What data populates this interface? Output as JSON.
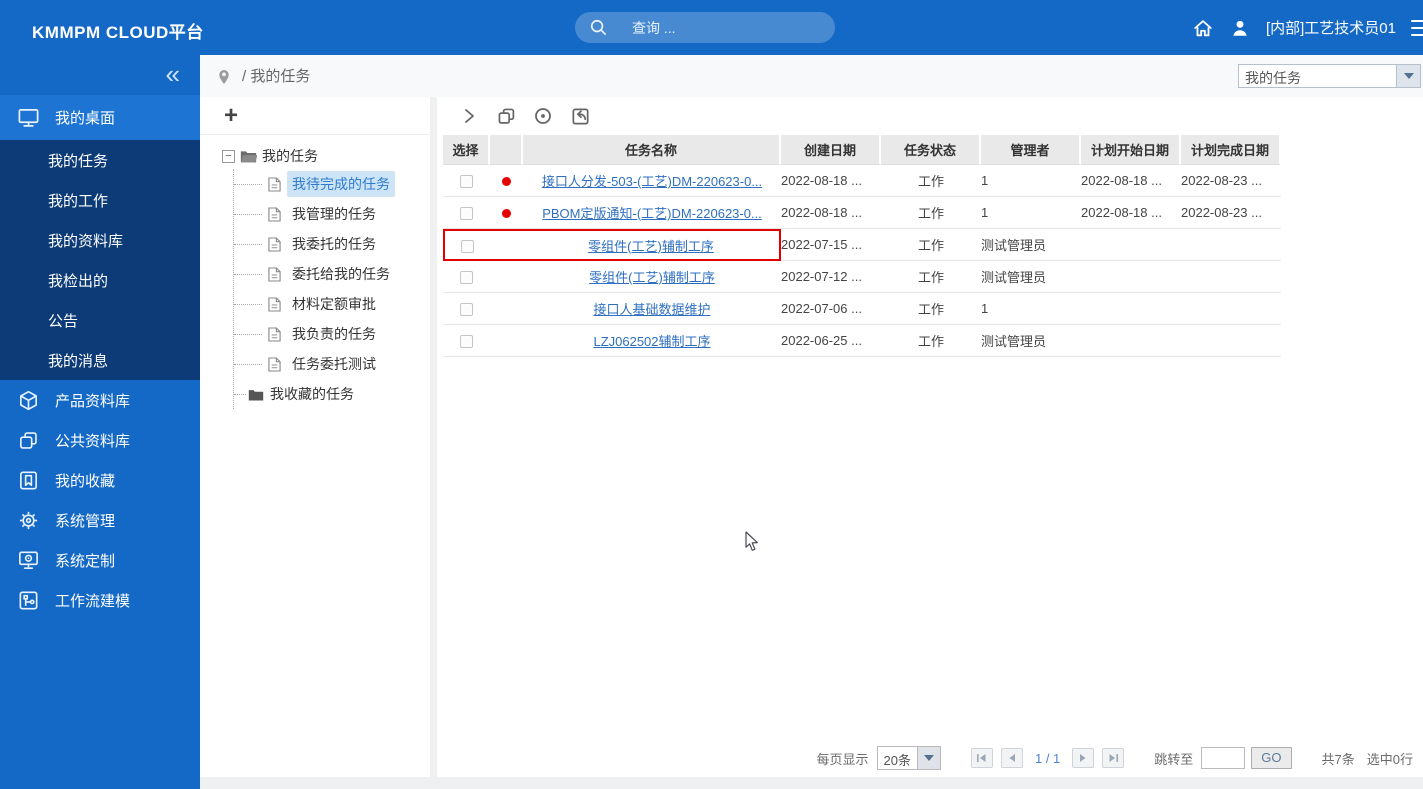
{
  "header": {
    "logo": "KMMPM CLOUD平台",
    "search_placeholder": "查询 ...",
    "user": "[内部]工艺技术员01"
  },
  "breadcrumb": {
    "path": "/ 我的任务"
  },
  "context_dropdown": {
    "value": "我的任务"
  },
  "sidebar": {
    "desktop_item": "我的桌面",
    "sub_items": [
      "我的任务",
      "我的工作",
      "我的资料库",
      "我检出的",
      "公告",
      "我的消息"
    ],
    "main_items": [
      {
        "label": "产品资料库",
        "icon": "cube-icon"
      },
      {
        "label": "公共资料库",
        "icon": "stack-icon"
      },
      {
        "label": "我的收藏",
        "icon": "bookmark-star-icon"
      },
      {
        "label": "系统管理",
        "icon": "gear-icon"
      },
      {
        "label": "系统定制",
        "icon": "monitor-gear-icon"
      },
      {
        "label": "工作流建模",
        "icon": "workflow-icon"
      }
    ]
  },
  "tree": {
    "add_button": "+",
    "root": "我的任务",
    "children": [
      "我待完成的任务",
      "我管理的任务",
      "我委托的任务",
      "委托给我的任务",
      "材料定额审批",
      "我负责的任务",
      "任务委托测试"
    ],
    "selected": "我待完成的任务",
    "favorite_node": "我收藏的任务"
  },
  "toolbar_icons": [
    "expand-icon",
    "copy-icon",
    "record-icon",
    "export-icon"
  ],
  "table": {
    "headers": [
      "选择",
      "",
      "任务名称",
      "创建日期",
      "任务状态",
      "管理者",
      "计划开始日期",
      "计划完成日期"
    ],
    "rows": [
      {
        "flag": true,
        "highlighted": false,
        "name": "接口人分发-503-(工艺)DM-220623-0...",
        "created": "2022-08-18 ...",
        "status": "工作",
        "manager": "1",
        "plan_start": "2022-08-18 ...",
        "plan_end": "2022-08-23 ..."
      },
      {
        "flag": true,
        "highlighted": false,
        "name": "PBOM定版通知-(工艺)DM-220623-0...",
        "created": "2022-08-18 ...",
        "status": "工作",
        "manager": "1",
        "plan_start": "2022-08-18 ...",
        "plan_end": "2022-08-23 ..."
      },
      {
        "flag": false,
        "highlighted": true,
        "name": "零组件(工艺)辅制工序",
        "created": "2022-07-15 ...",
        "status": "工作",
        "manager": "测试管理员",
        "plan_start": "",
        "plan_end": ""
      },
      {
        "flag": false,
        "highlighted": false,
        "name": "零组件(工艺)辅制工序",
        "created": "2022-07-12 ...",
        "status": "工作",
        "manager": "测试管理员",
        "plan_start": "",
        "plan_end": ""
      },
      {
        "flag": false,
        "highlighted": false,
        "name": "接口人基础数据维护",
        "created": "2022-07-06 ...",
        "status": "工作",
        "manager": "1",
        "plan_start": "",
        "plan_end": ""
      },
      {
        "flag": false,
        "highlighted": false,
        "name": "LZJ062502辅制工序",
        "created": "2022-06-25 ...",
        "status": "工作",
        "manager": "测试管理员",
        "plan_start": "",
        "plan_end": ""
      }
    ]
  },
  "pagination": {
    "per_page_label": "每页显示",
    "per_page_value": "20条",
    "page_indicator": "1 / 1",
    "jump_label": "跳转至",
    "go_label": "GO",
    "total": "共7条",
    "selected_rows": "选中0行"
  },
  "colors": {
    "header_blue": "#1569c6",
    "submenu_navy": "#0c3b77",
    "active_blue": "#1d74d2",
    "selection_bg": "#cde4f7",
    "link_blue": "#2e6fc2",
    "alert_red": "#e60000"
  }
}
